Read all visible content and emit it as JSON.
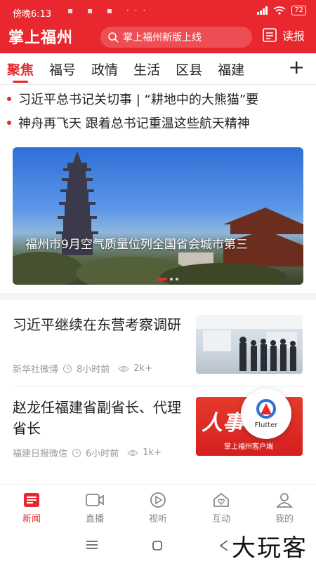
{
  "status_bar": {
    "time": "傍晚6:13",
    "icons_left": "▪ ▪ ▪ ···",
    "battery": "72"
  },
  "header": {
    "logo_text": "掌上福州",
    "search_placeholder": "掌上福州新版上线",
    "newspaper_label": "读报"
  },
  "tabs": [
    {
      "label": "聚焦",
      "active": true
    },
    {
      "label": "福号"
    },
    {
      "label": "政情"
    },
    {
      "label": "生活"
    },
    {
      "label": "区县"
    },
    {
      "label": "福建"
    }
  ],
  "headlines": [
    "习近平总书记关切事 | “耕地中的大熊猫”要",
    "神舟再飞天 跟着总书记重温这些航天精神"
  ],
  "banner": {
    "caption": "福州市9月空气质量位列全国省会城市第三"
  },
  "news": [
    {
      "title": "习近平继续在东营考察调研",
      "source": "新华社微博",
      "time": "8小时前",
      "views": "2k+"
    },
    {
      "title": "赵龙任福建省副省长、代理省长",
      "source": "福建日报微信",
      "time": "6小时前",
      "views": "1k+"
    }
  ],
  "thumb2_text": {
    "big": "人事",
    "small": "掌上福州客户端"
  },
  "flutter_badge": "Flutter",
  "bottom_nav": [
    {
      "label": "新闻",
      "icon": "news-icon",
      "active": true
    },
    {
      "label": "直播",
      "icon": "video-icon"
    },
    {
      "label": "视听",
      "icon": "play-icon"
    },
    {
      "label": "互动",
      "icon": "heart-home-icon"
    },
    {
      "label": "我的",
      "icon": "user-icon"
    }
  ],
  "watermark": "大玩客",
  "colors": {
    "brand_red": "#e8282e",
    "muted_text": "#999999"
  }
}
